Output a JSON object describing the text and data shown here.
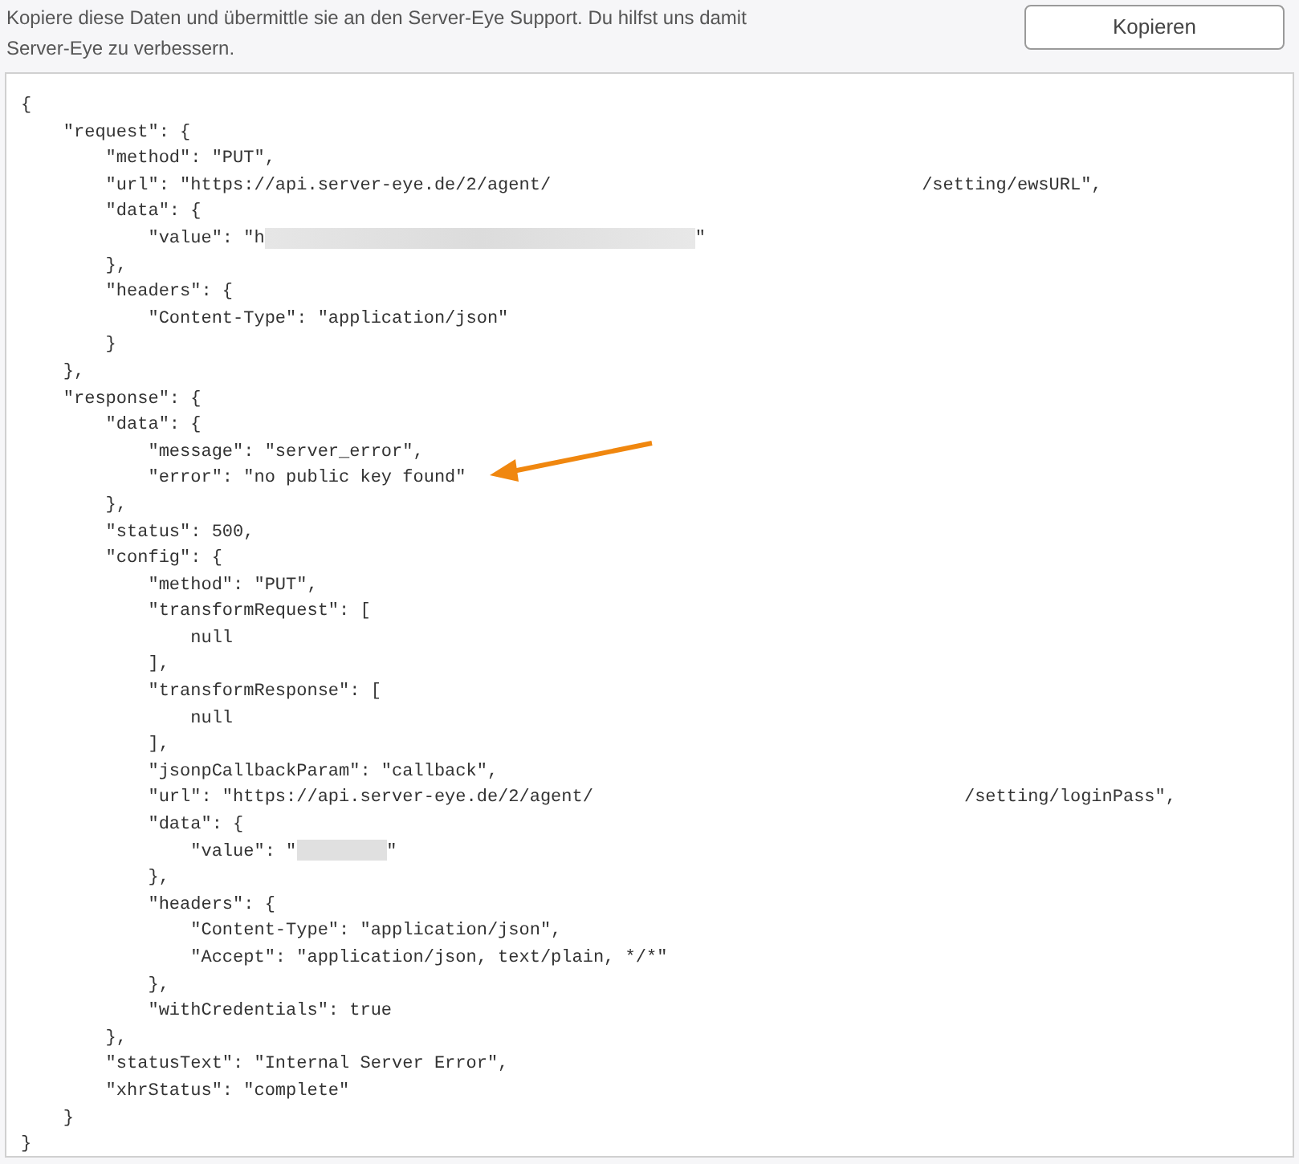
{
  "intro": "Kopiere diese Daten und übermittle sie an den Server-Eye Support. Du hilfst uns damit Server-Eye zu verbessern.",
  "copy_button": "Kopieren",
  "code_lines": [
    [
      {
        "kind": "code",
        "text": "{"
      }
    ],
    [
      {
        "kind": "code",
        "text": "    \"request\": {"
      }
    ],
    [
      {
        "kind": "code",
        "text": "        \"method\": \"PUT\","
      }
    ],
    [
      {
        "kind": "code",
        "text": "        \"url\": \"https://api.server-eye.de/2/agent/"
      },
      {
        "kind": "gap"
      },
      {
        "kind": "code",
        "text": "/setting/ewsURL\","
      }
    ],
    [
      {
        "kind": "code",
        "text": "        \"data\": {"
      }
    ],
    [
      {
        "kind": "code",
        "text": "            \"value\": \"h"
      },
      {
        "kind": "redacted"
      },
      {
        "kind": "code",
        "text": "\""
      }
    ],
    [
      {
        "kind": "code",
        "text": "        },"
      }
    ],
    [
      {
        "kind": "code",
        "text": "        \"headers\": {"
      }
    ],
    [
      {
        "kind": "code",
        "text": "            \"Content-Type\": \"application/json\""
      }
    ],
    [
      {
        "kind": "code",
        "text": "        }"
      }
    ],
    [
      {
        "kind": "code",
        "text": "    },"
      }
    ],
    [
      {
        "kind": "code",
        "text": "    \"response\": {"
      }
    ],
    [
      {
        "kind": "code",
        "text": "        \"data\": {"
      }
    ],
    [
      {
        "kind": "code",
        "text": "            \"message\": \"server_error\","
      }
    ],
    [
      {
        "kind": "code",
        "text": "            \"error\": \"no public key found\""
      }
    ],
    [
      {
        "kind": "code",
        "text": "        },"
      }
    ],
    [
      {
        "kind": "code",
        "text": "        \"status\": 500,"
      }
    ],
    [
      {
        "kind": "code",
        "text": "        \"config\": {"
      }
    ],
    [
      {
        "kind": "code",
        "text": "            \"method\": \"PUT\","
      }
    ],
    [
      {
        "kind": "code",
        "text": "            \"transformRequest\": ["
      }
    ],
    [
      {
        "kind": "code",
        "text": "                null"
      }
    ],
    [
      {
        "kind": "code",
        "text": "            ],"
      }
    ],
    [
      {
        "kind": "code",
        "text": "            \"transformResponse\": ["
      }
    ],
    [
      {
        "kind": "code",
        "text": "                null"
      }
    ],
    [
      {
        "kind": "code",
        "text": "            ],"
      }
    ],
    [
      {
        "kind": "code",
        "text": "            \"jsonpCallbackParam\": \"callback\","
      }
    ],
    [
      {
        "kind": "code",
        "text": "            \"url\": \"https://api.server-eye.de/2/agent/"
      },
      {
        "kind": "gap"
      },
      {
        "kind": "code",
        "text": "/setting/loginPass\","
      }
    ],
    [
      {
        "kind": "code",
        "text": "            \"data\": {"
      }
    ],
    [
      {
        "kind": "code",
        "text": "                \"value\": \""
      },
      {
        "kind": "redacted_short"
      },
      {
        "kind": "code",
        "text": "\""
      }
    ],
    [
      {
        "kind": "code",
        "text": "            },"
      }
    ],
    [
      {
        "kind": "code",
        "text": "            \"headers\": {"
      }
    ],
    [
      {
        "kind": "code",
        "text": "                \"Content-Type\": \"application/json\","
      }
    ],
    [
      {
        "kind": "code",
        "text": "                \"Accept\": \"application/json, text/plain, */*\""
      }
    ],
    [
      {
        "kind": "code",
        "text": "            },"
      }
    ],
    [
      {
        "kind": "code",
        "text": "            \"withCredentials\": true"
      }
    ],
    [
      {
        "kind": "code",
        "text": "        },"
      }
    ],
    [
      {
        "kind": "code",
        "text": "        \"statusText\": \"Internal Server Error\","
      }
    ],
    [
      {
        "kind": "code",
        "text": "        \"xhrStatus\": \"complete\""
      }
    ],
    [
      {
        "kind": "code",
        "text": "    }"
      }
    ],
    [
      {
        "kind": "code",
        "text": "}"
      }
    ]
  ]
}
